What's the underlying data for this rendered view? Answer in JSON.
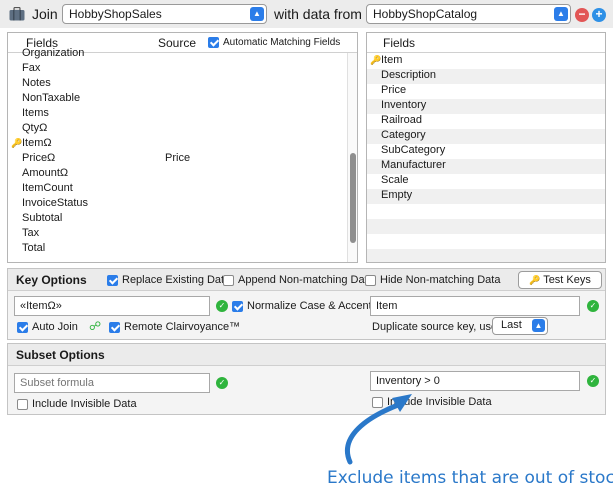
{
  "top_bar": {
    "join_label": "Join",
    "target_file": "HobbyShopSales",
    "with_label": "with data from",
    "source_file": "HobbyShopCatalog",
    "remove_label": "−",
    "add_label": "+"
  },
  "left_table": {
    "fields_header": "Fields",
    "source_header": "Source",
    "auto_match_label": "Automatic Matching Fields",
    "auto_match_checked": true,
    "rows": [
      {
        "name": "Organization",
        "source": "",
        "key": false
      },
      {
        "name": "Fax",
        "source": "",
        "key": false
      },
      {
        "name": "Notes",
        "source": "",
        "key": false
      },
      {
        "name": "NonTaxable",
        "source": "",
        "key": false
      },
      {
        "name": "Items",
        "source": "",
        "key": false
      },
      {
        "name": "QtyΩ",
        "source": "",
        "key": false
      },
      {
        "name": "ItemΩ",
        "source": "",
        "key": true
      },
      {
        "name": "PriceΩ",
        "source": "Price",
        "key": false
      },
      {
        "name": "AmountΩ",
        "source": "",
        "key": false
      },
      {
        "name": "ItemCount",
        "source": "",
        "key": false
      },
      {
        "name": "InvoiceStatus",
        "source": "",
        "key": false
      },
      {
        "name": "Subtotal",
        "source": "",
        "key": false
      },
      {
        "name": "Tax",
        "source": "",
        "key": false
      },
      {
        "name": "Total",
        "source": "",
        "key": false
      }
    ]
  },
  "right_table": {
    "fields_header": "Fields",
    "rows": [
      {
        "name": "Item",
        "key": true
      },
      {
        "name": "Description",
        "key": false
      },
      {
        "name": "Price",
        "key": false
      },
      {
        "name": "Inventory",
        "key": false
      },
      {
        "name": "Railroad",
        "key": false
      },
      {
        "name": "Category",
        "key": false
      },
      {
        "name": "SubCategory",
        "key": false
      },
      {
        "name": "Manufacturer",
        "key": false
      },
      {
        "name": "Scale",
        "key": false
      },
      {
        "name": "Empty",
        "key": false
      }
    ]
  },
  "key_options": {
    "title": "Key Options",
    "replace_existing": {
      "label": "Replace Existing Data",
      "checked": true
    },
    "append_nonmatching": {
      "label": "Append Non-matching Data",
      "checked": false
    },
    "hide_nonmatching": {
      "label": "Hide Non-matching Data",
      "checked": false
    },
    "test_keys_label": "Test Keys",
    "target_key_value": "«ItemΩ»",
    "normalize": {
      "label": "Normalize Case & Accents",
      "checked": true
    },
    "source_key_value": "Item",
    "auto_join": {
      "label": "Auto Join",
      "checked": true
    },
    "remote_clairvoyance": {
      "label": "Remote Clairvoyance™",
      "checked": true
    },
    "duplicate_label": "Duplicate source key, use:",
    "duplicate_value": "Last"
  },
  "subset_options": {
    "title": "Subset Options",
    "target_formula_placeholder": "Subset formula",
    "target_formula_value": "",
    "target_invisible": {
      "label": "Include Invisible Data",
      "checked": false
    },
    "source_formula_value": "Inventory > 0",
    "source_invisible": {
      "label": "Include Invisible Data",
      "checked": false
    }
  },
  "annotation": {
    "text": "Exclude items that are out of stock",
    "color": "#2a78c9"
  },
  "colors": {
    "accent": "#2b7de9",
    "ok": "#2fb43d",
    "remove": "#e25656",
    "add": "#2e90e6"
  }
}
